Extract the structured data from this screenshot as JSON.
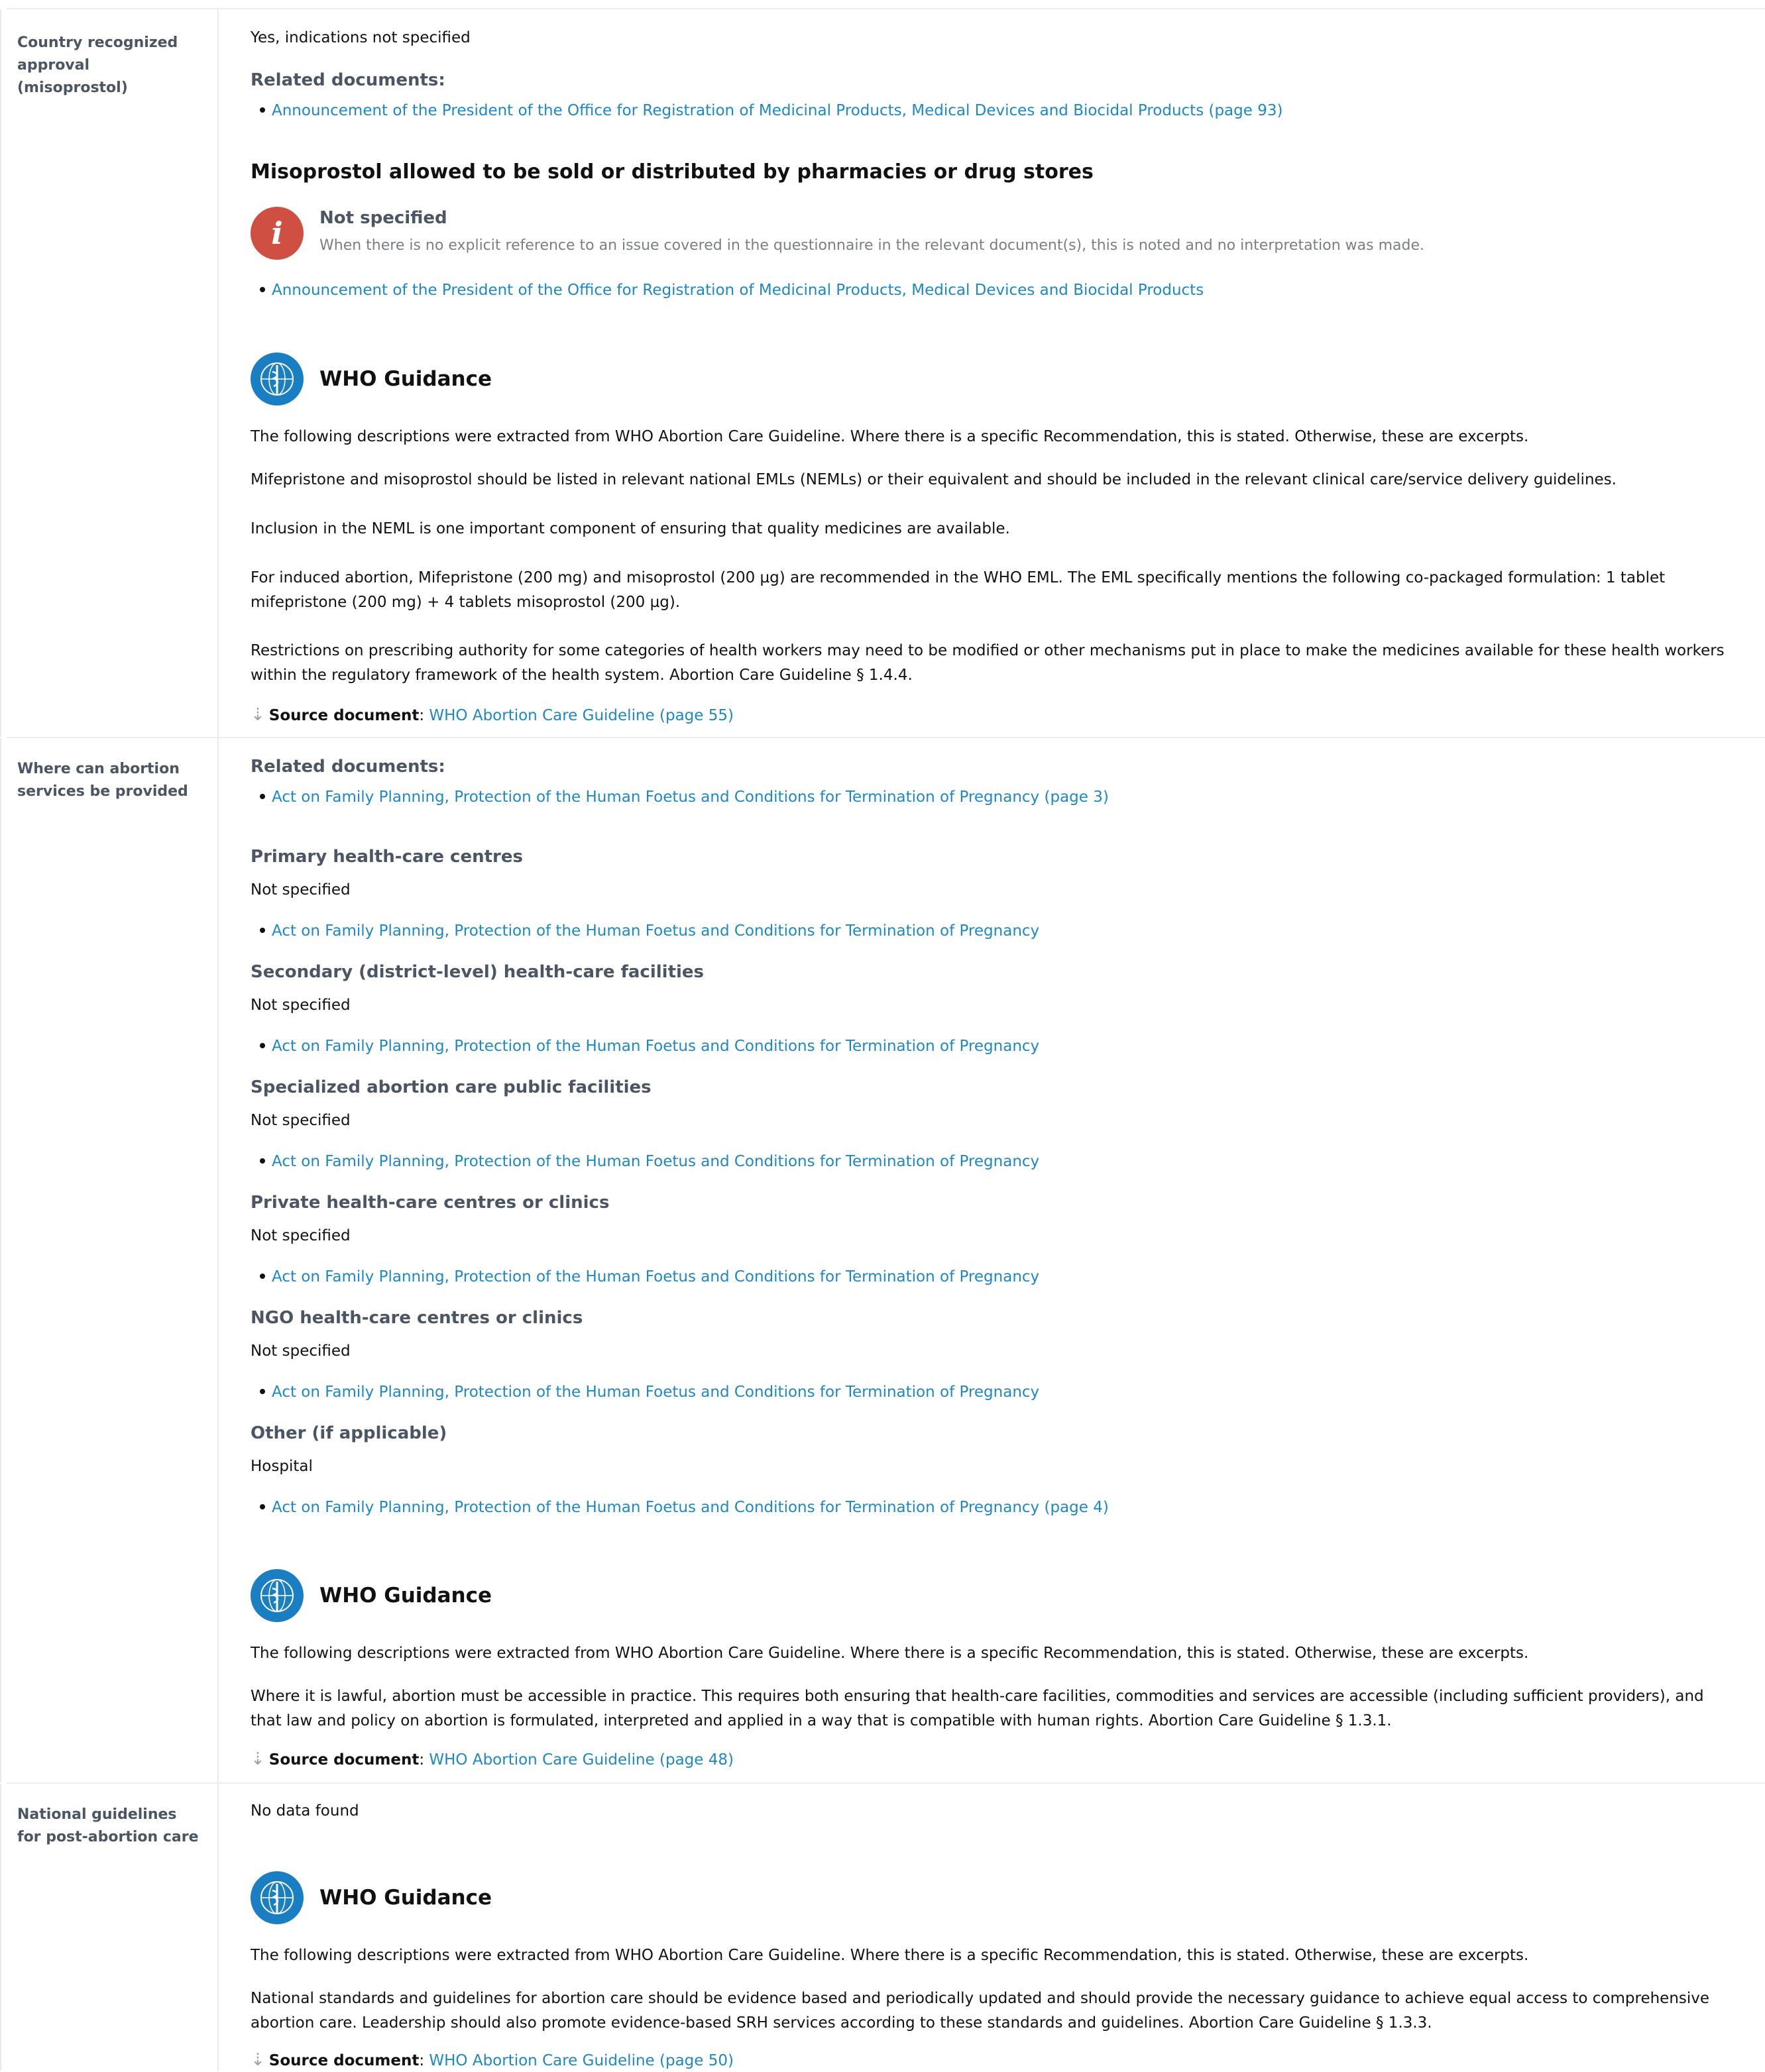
{
  "rows": [
    {
      "label": [
        "Country recognized",
        "approval",
        "(misoprostol)"
      ],
      "answer": "Yes, indications not specified",
      "related_heading": "Related documents:",
      "related_link": "Announcement of the President of the Office for Registration of Medicinal Products, Medical Devices and Biocidal Products (page 93)",
      "section_title": "Misoprostol allowed to be sold or distributed by pharmacies or drug stores",
      "not_specified": {
        "title": "Not specified",
        "desc": "When there is no explicit reference to an issue covered in the questionnaire in the relevant document(s), this is noted and no interpretation was made.",
        "link": "Announcement of the President of the Office for Registration of Medicinal Products, Medical Devices and Biocidal Products"
      },
      "who": {
        "title": "WHO Guidance",
        "intro": "The following descriptions were extracted from WHO Abortion Care Guideline. Where there is a specific Recommendation, this is stated. Otherwise, these are excerpts.",
        "paragraphs": [
          "Mifepristone and misoprostol should be listed in relevant national EMLs (NEMLs) or their equivalent and should be included in the relevant clinical care/service delivery guidelines.",
          "Inclusion in the NEML is one important component of ensuring that quality medicines are available.",
          "For induced abortion, Mifepristone (200 mg) and misoprostol (200 µg) are recommended in the WHO EML. The EML specifically mentions the following co-packaged formulation: 1 tablet mifepristone (200 mg) + 4 tablets misoprostol (200 µg).",
          "Restrictions on prescribing authority for some categories of health workers may need to be modified or other mechanisms put in place to make the medicines available for these health workers within the regulatory framework of the health system. Abortion Care Guideline § 1.4.4."
        ],
        "source_label": "Source document",
        "source_link": "WHO Abortion Care Guideline (page 55)"
      }
    },
    {
      "label": [
        "Where can abortion",
        "services be provided"
      ],
      "related_heading": "Related documents:",
      "related_link": "Act on Family Planning, Protection of the Human Foetus and Conditions for Termination of Pregnancy (page 3)",
      "facilities": [
        {
          "title": "Primary health-care centres",
          "value": "Not specified",
          "link": "Act on Family Planning, Protection of the Human Foetus and Conditions for Termination of Pregnancy"
        },
        {
          "title": "Secondary (district-level) health-care facilities",
          "value": "Not specified",
          "link": "Act on Family Planning, Protection of the Human Foetus and Conditions for Termination of Pregnancy"
        },
        {
          "title": "Specialized abortion care public facilities",
          "value": "Not specified",
          "link": "Act on Family Planning, Protection of the Human Foetus and Conditions for Termination of Pregnancy"
        },
        {
          "title": "Private health-care centres or clinics",
          "value": "Not specified",
          "link": "Act on Family Planning, Protection of the Human Foetus and Conditions for Termination of Pregnancy"
        },
        {
          "title": "NGO health-care centres or clinics",
          "value": "Not specified",
          "link": "Act on Family Planning, Protection of the Human Foetus and Conditions for Termination of Pregnancy"
        },
        {
          "title": "Other (if applicable)",
          "value": "Hospital",
          "link": "Act on Family Planning, Protection of the Human Foetus and Conditions for Termination of Pregnancy (page 4)"
        }
      ],
      "who": {
        "title": "WHO Guidance",
        "intro": "The following descriptions were extracted from WHO Abortion Care Guideline. Where there is a specific Recommendation, this is stated. Otherwise, these are excerpts.",
        "paragraph": "Where it is lawful, abortion must be accessible in practice. This requires both ensuring that health-care facilities, commodities and services are accessible (including sufficient providers), and that law and policy on abortion is formulated, interpreted and applied in a way that is compatible with human rights. Abortion Care Guideline § 1.3.1.",
        "source_label": "Source document",
        "source_link": "WHO Abortion Care Guideline (page 48)"
      }
    },
    {
      "label": [
        "National guidelines",
        "for post-abortion care"
      ],
      "answer": "No data found",
      "who": {
        "title": "WHO Guidance",
        "intro": "The following descriptions were extracted from WHO Abortion Care Guideline. Where there is a specific Recommendation, this is stated. Otherwise, these are excerpts.",
        "paragraph": "National standards and guidelines for abortion care should be evidence based and periodically updated and should provide the necessary guidance to achieve equal access to comprehensive abortion care. Leadership should also promote evidence-based SRH services according to these standards and guidelines. Abortion Care Guideline § 1.3.3.",
        "source_label": "Source document",
        "source_link": "WHO Abortion Care Guideline (page 50)"
      }
    }
  ],
  "icons": {
    "who": "who-emblem-icon",
    "info": "info-icon",
    "arrow": "arrow-down-icon"
  },
  "colors": {
    "link": "#1e88c3",
    "who_blue": "#1a7ec2",
    "info_red": "#cf5042",
    "label_gray": "#4b5563"
  }
}
